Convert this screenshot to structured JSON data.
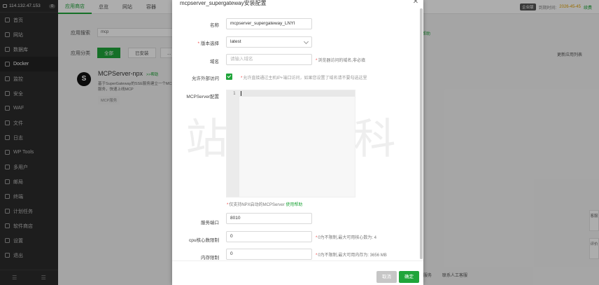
{
  "sidebar": {
    "ip": "114.132.47.153",
    "badge": "0",
    "items": [
      {
        "label": "首页",
        "icon": "home-icon"
      },
      {
        "label": "网站",
        "icon": "globe-icon"
      },
      {
        "label": "数据库",
        "icon": "database-icon"
      },
      {
        "label": "Docker",
        "icon": "docker-icon",
        "active": true
      },
      {
        "label": "监控",
        "icon": "monitor-icon"
      },
      {
        "label": "安全",
        "icon": "shield-icon"
      },
      {
        "label": "WAF",
        "icon": "waf-icon"
      },
      {
        "label": "文件",
        "icon": "folder-icon"
      },
      {
        "label": "日志",
        "icon": "log-icon"
      },
      {
        "label": "WP Tools",
        "icon": "wordpress-icon"
      },
      {
        "label": "多用户",
        "icon": "users-icon"
      },
      {
        "label": "邮局",
        "icon": "mail-icon"
      },
      {
        "label": "终端",
        "icon": "terminal-icon"
      },
      {
        "label": "计划任务",
        "icon": "clock-icon"
      },
      {
        "label": "软件商店",
        "icon": "store-icon"
      },
      {
        "label": "设置",
        "icon": "gear-icon"
      },
      {
        "label": "退出",
        "icon": "logout-icon"
      }
    ],
    "footer_left": "☰",
    "footer_right": "☰"
  },
  "topbar": {
    "tabs": [
      "应用商店",
      "总览",
      "网站",
      "容器"
    ],
    "badge": "企业版",
    "expire_label": "到期时间:",
    "expire_date": "2026-45-45",
    "renew": "续费"
  },
  "background": {
    "search_label": "应用搜索",
    "search_value": "mcp",
    "category_label": "应用分类",
    "categories": [
      "全部",
      "已安装",
      "..."
    ],
    "update_link": "更新应用列表",
    "help_link": "帮助",
    "app": {
      "name": "MCPServer-npx",
      "help": ">>帮助",
      "logo_char": "S",
      "desc": "基于SuperGateway的SSE服务建立一个MCP服务，快速上线MCP",
      "tag": "MCP服务"
    },
    "bottom_links": [
      "联系人工客服"
    ],
    "float_tabs": [
      "客服",
      "评价"
    ]
  },
  "modal": {
    "title": "mcpserver_supergateway安装配置",
    "fields": {
      "name": {
        "label": "名称",
        "value": "mcpserver_supergateway_LNYI"
      },
      "version": {
        "label": "版本选择",
        "value": "latest",
        "required": true
      },
      "domain": {
        "label": "域名",
        "placeholder": "请输入域名",
        "hint": "浏览器访问的域名,非必填"
      },
      "external": {
        "label": "允许外部访问",
        "checked": true,
        "hint": "允许直接通过主机IP+端口访问，如果您设置了域名请不要勾选这里"
      },
      "config": {
        "label": "MCPServer配置",
        "line_number": "1",
        "hint_prefix": "仅支持NPX启动的MCPServer",
        "hint_link": "使用帮助"
      },
      "port": {
        "label": "服务端口",
        "value": "8010"
      },
      "cpu": {
        "label": "cpu核心数限制",
        "value": "0",
        "hint": "0为不限制,最大可用核心数为: 4"
      },
      "memory": {
        "label": "内存限制",
        "value": "0",
        "hint": "0为不限制,最大可用内存为: 3656 MB"
      }
    },
    "watermark": "站长百科",
    "cancel": "取消",
    "confirm": "确定"
  },
  "colors": {
    "accent": "#20a53a",
    "sidebar": "#2b2b2b",
    "required": "#f04444"
  }
}
